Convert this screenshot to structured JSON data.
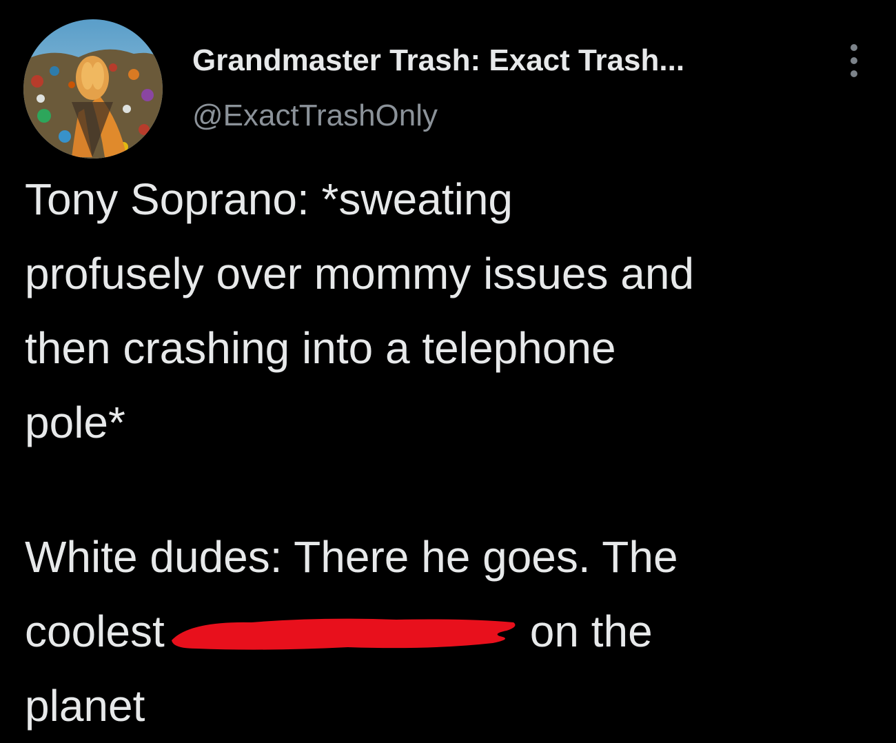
{
  "tweet": {
    "display_name": "Grandmaster Trash: Exact Trash...",
    "handle": "@ExactTrashOnly",
    "body": {
      "paragraph1_lines": [
        "Tony Soprano: *sweating",
        "profusely over mommy issues and",
        "then crashing into a telephone",
        "pole*"
      ],
      "paragraph2_line1": "White dudes: There he goes. The",
      "paragraph2_line2_before": "coolest",
      "paragraph2_line2_after": "on the",
      "paragraph2_line3": "planet"
    },
    "redaction_color": "#e8101c",
    "more_icon": "vertical-ellipsis-icon"
  }
}
